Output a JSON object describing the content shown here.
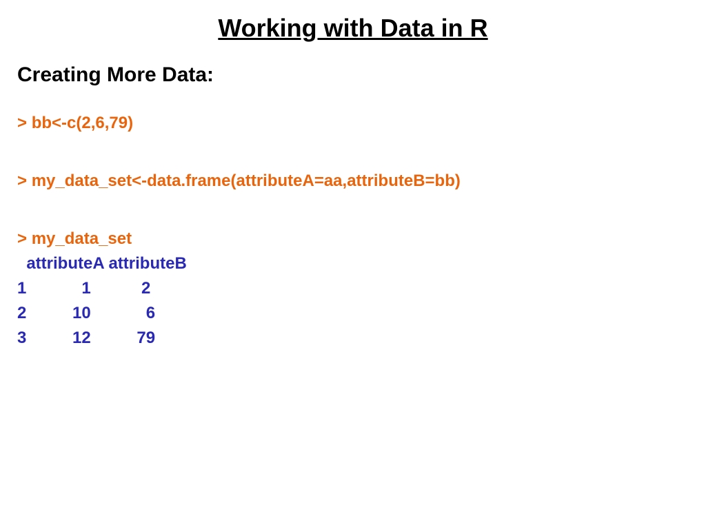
{
  "title": "Working with Data in R",
  "subtitle": "Creating More Data:",
  "code": {
    "prompt": ">",
    "cmd1": "bb<-c(2,6,79)",
    "cmd2": "my_data_set<-data.frame(attributeA=aa,attributeB=bb)",
    "cmd3": "my_data_set"
  },
  "output": {
    "header": "  attributeA attributeB",
    "row1": "1            1           2",
    "row2": "2          10            6",
    "row3": "3          12          79"
  }
}
